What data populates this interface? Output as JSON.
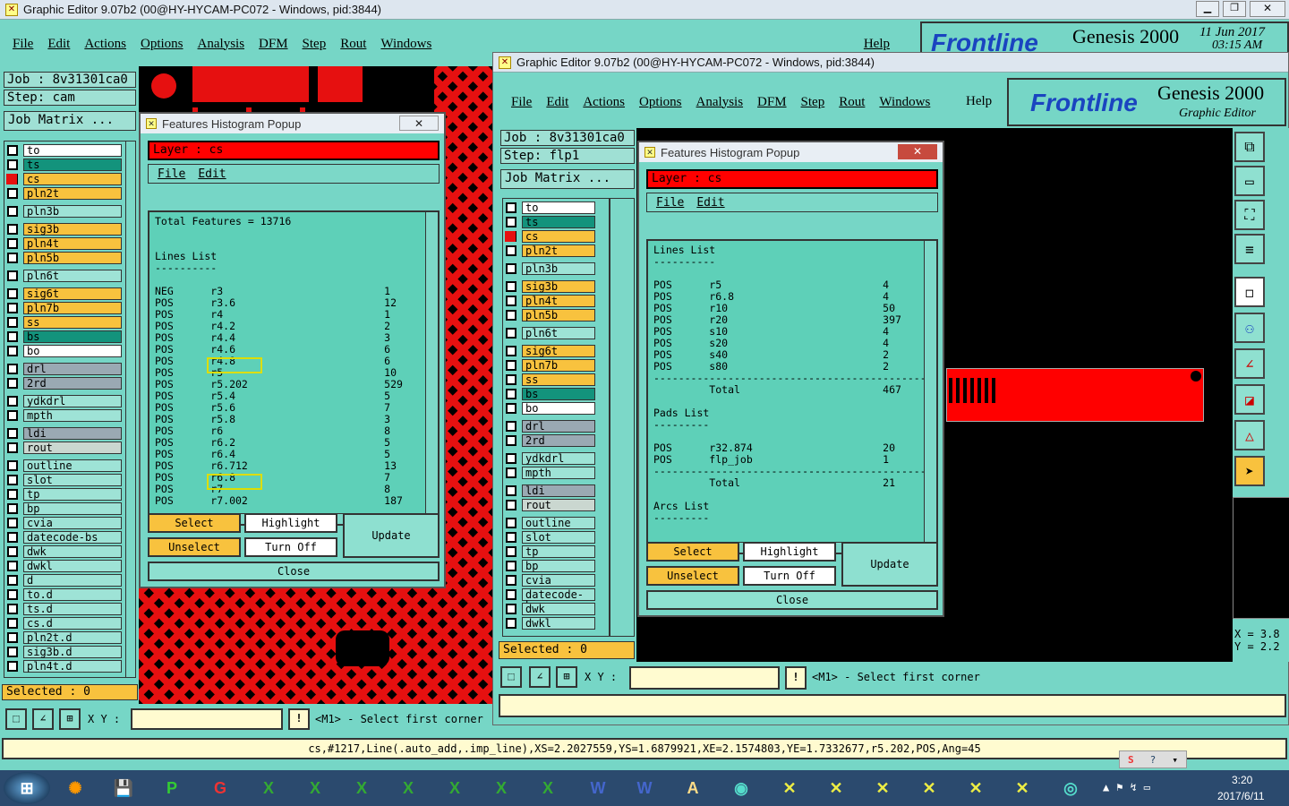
{
  "main_window": {
    "title": "Graphic Editor 9.07b2 (00@HY-HYCAM-PC072 - Windows, pid:3844)",
    "menu": [
      "File",
      "Edit",
      "Actions",
      "Options",
      "Analysis",
      "DFM",
      "Step",
      "Rout",
      "Windows"
    ],
    "help": "Help",
    "brand": "Frontline",
    "product": "Genesis 2000",
    "date": "11 Jun 2017",
    "time": "03:15 AM",
    "job": "Job  : 8v31301ca0",
    "step": "Step: cam",
    "job_matrix": "Job Matrix ...",
    "selected": "Selected : 0",
    "xy_label": "X Y :",
    "prompt": "<M1> - Select first corner",
    "status_line": "cs,#1217,Line(.auto_add,.imp_line),XS=2.2027559,YS=1.6879921,XE=2.1574803,YE=1.7332677,r5.202,POS,Ang=45"
  },
  "layers_left": [
    {
      "name": "to",
      "color": "w"
    },
    {
      "name": "ts",
      "color": "g"
    },
    {
      "name": "cs",
      "color": "o",
      "active": true
    },
    {
      "name": "pln2t",
      "color": "o"
    },
    {
      "gap": true
    },
    {
      "name": "pln3b",
      "color": "t"
    },
    {
      "gap": true
    },
    {
      "name": "sig3b",
      "color": "o"
    },
    {
      "name": "pln4t",
      "color": "o"
    },
    {
      "name": "pln5b",
      "color": "o"
    },
    {
      "gap": true
    },
    {
      "name": "pln6t",
      "color": "t"
    },
    {
      "gap": true
    },
    {
      "name": "sig6t",
      "color": "o"
    },
    {
      "name": "pln7b",
      "color": "o"
    },
    {
      "name": "ss",
      "color": "o"
    },
    {
      "name": "bs",
      "color": "g"
    },
    {
      "name": "bo",
      "color": "w"
    },
    {
      "gap": true
    },
    {
      "name": "drl",
      "color": "s"
    },
    {
      "name": "2rd",
      "color": "s"
    },
    {
      "gap": true
    },
    {
      "name": "ydkdrl",
      "color": "t"
    },
    {
      "name": "mpth",
      "color": "t"
    },
    {
      "gap": true
    },
    {
      "name": "ldi",
      "color": "s"
    },
    {
      "name": "rout",
      "color": "l"
    },
    {
      "gap": true
    },
    {
      "name": "outline",
      "color": "t"
    },
    {
      "name": "slot",
      "color": "t"
    },
    {
      "name": "tp",
      "color": "t"
    },
    {
      "name": "bp",
      "color": "t"
    },
    {
      "name": "cvia",
      "color": "t"
    },
    {
      "name": "datecode-bs",
      "color": "t"
    },
    {
      "name": "dwk",
      "color": "t"
    },
    {
      "name": "dwkl",
      "color": "t"
    },
    {
      "name": "d",
      "color": "t"
    },
    {
      "name": "to.d",
      "color": "t"
    },
    {
      "name": "ts.d",
      "color": "t"
    },
    {
      "name": "cs.d",
      "color": "t"
    },
    {
      "name": "pln2t.d",
      "color": "t"
    },
    {
      "name": "sig3b.d",
      "color": "t"
    },
    {
      "name": "pln4t.d",
      "color": "t"
    }
  ],
  "popup_left": {
    "title": "Features Histogram Popup",
    "layer": "Layer :  cs",
    "menu": [
      "File",
      "Edit"
    ],
    "content": "Total Features = 13716\n\n\nLines List\n----------\n\nNEG      r3                          1\nPOS      r3.6                        12\nPOS      r4                          1\nPOS      r4.2                        2\nPOS      r4.4                        3\nPOS      r4.6                        6\nPOS      r4.8                        6\nPOS      r5                          10\nPOS      r5.202                      529\nPOS      r5.4                        5\nPOS      r5.6                        7\nPOS      r5.8                        3\nPOS      r6                          8\nPOS      r6.2                        5\nPOS      r6.4                        5\nPOS      r6.712                      13\nPOS      r6.8                        7\nPOS      r7                          8\nPOS      r7.002                      187",
    "buttons": {
      "select": "Select",
      "highlight": "Highlight",
      "update": "Update",
      "unselect": "Unselect",
      "turn_off": "Turn Off",
      "close": "Close"
    }
  },
  "second_window": {
    "title": "Graphic Editor 9.07b2 (00@HY-HYCAM-PC072 - Windows, pid:3844)",
    "menu": [
      "File",
      "Edit",
      "Actions",
      "Options",
      "Analysis",
      "DFM",
      "Step",
      "Rout",
      "Windows"
    ],
    "help": "Help",
    "brand": "Frontline",
    "product": "Genesis 2000",
    "subtitle": "Graphic Editor",
    "job": "Job  : 8v31301ca0",
    "step": "Step: flp1",
    "job_matrix": "Job Matrix ...",
    "selected": "Selected : 0",
    "xy_label": "X Y :",
    "prompt": "<M1> - Select first corner",
    "coord_x": "X = 3.8",
    "coord_y": "Y = 2.2"
  },
  "layers_right": [
    {
      "name": "to",
      "color": "w"
    },
    {
      "name": "ts",
      "color": "g"
    },
    {
      "name": "cs",
      "color": "o",
      "active": true
    },
    {
      "name": "pln2t",
      "color": "o"
    },
    {
      "gap": true
    },
    {
      "name": "pln3b",
      "color": "t"
    },
    {
      "gap": true
    },
    {
      "name": "sig3b",
      "color": "o"
    },
    {
      "name": "pln4t",
      "color": "o"
    },
    {
      "name": "pln5b",
      "color": "o"
    },
    {
      "gap": true
    },
    {
      "name": "pln6t",
      "color": "t"
    },
    {
      "gap": true
    },
    {
      "name": "sig6t",
      "color": "o"
    },
    {
      "name": "pln7b",
      "color": "o"
    },
    {
      "name": "ss",
      "color": "o"
    },
    {
      "name": "bs",
      "color": "g"
    },
    {
      "name": "bo",
      "color": "w"
    },
    {
      "gap": true
    },
    {
      "name": "drl",
      "color": "s"
    },
    {
      "name": "2rd",
      "color": "s"
    },
    {
      "gap": true
    },
    {
      "name": "ydkdrl",
      "color": "t"
    },
    {
      "name": "mpth",
      "color": "t"
    },
    {
      "gap": true
    },
    {
      "name": "ldi",
      "color": "s"
    },
    {
      "name": "rout",
      "color": "l"
    },
    {
      "gap": true
    },
    {
      "name": "outline",
      "color": "t"
    },
    {
      "name": "slot",
      "color": "t"
    },
    {
      "name": "tp",
      "color": "t"
    },
    {
      "name": "bp",
      "color": "t"
    },
    {
      "name": "cvia",
      "color": "t"
    },
    {
      "name": "datecode-bs",
      "color": "t"
    },
    {
      "name": "dwk",
      "color": "t"
    },
    {
      "name": "dwkl",
      "color": "t"
    }
  ],
  "popup_right": {
    "title": "Features Histogram Popup",
    "layer": "Layer :  cs",
    "menu": [
      "File",
      "Edit"
    ],
    "content": "Lines List\n----------\n\nPOS      r5                          4\nPOS      r6.8                        4\nPOS      r10                         50\nPOS      r20                         397\nPOS      s10                         4\nPOS      s20                         4\nPOS      s40                         2\nPOS      s80                         2\n--------------------------------------------\n         Total                       467\n\nPads List\n---------\n\nPOS      r32.874                     20\nPOS      flp_job                     1\n--------------------------------------------\n         Total                       21\n\nArcs List\n---------",
    "buttons": {
      "select": "Select",
      "highlight": "Highlight",
      "update": "Update",
      "unselect": "Unselect",
      "turn_off": "Turn Off",
      "close": "Close"
    }
  },
  "taskbar": {
    "time": "3:20",
    "date": "2017/6/11"
  }
}
